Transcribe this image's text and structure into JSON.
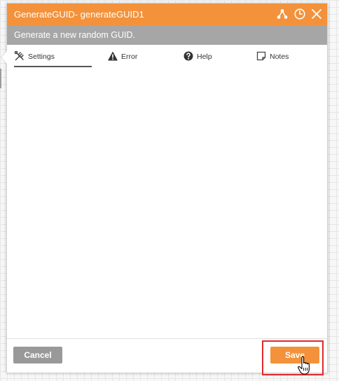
{
  "dialog": {
    "title": "GenerateGUID- generateGUID1",
    "subtitle": "Generate a new random GUID.",
    "title_icons": [
      "workflow-icon",
      "clock-icon",
      "close-icon"
    ]
  },
  "tabs": [
    {
      "label": "Settings",
      "icon": "tools-icon",
      "active": true
    },
    {
      "label": "Error",
      "icon": "warning-icon",
      "active": false
    },
    {
      "label": "Help",
      "icon": "question-circle-icon",
      "active": false
    },
    {
      "label": "Notes",
      "icon": "note-icon",
      "active": false
    }
  ],
  "footer": {
    "cancel_label": "Cancel",
    "save_label": "Save"
  },
  "colors": {
    "accent": "#f3923b",
    "subtitle_bar": "#a6a6a6",
    "cancel_button": "#999999",
    "highlight": "#e3282b"
  }
}
